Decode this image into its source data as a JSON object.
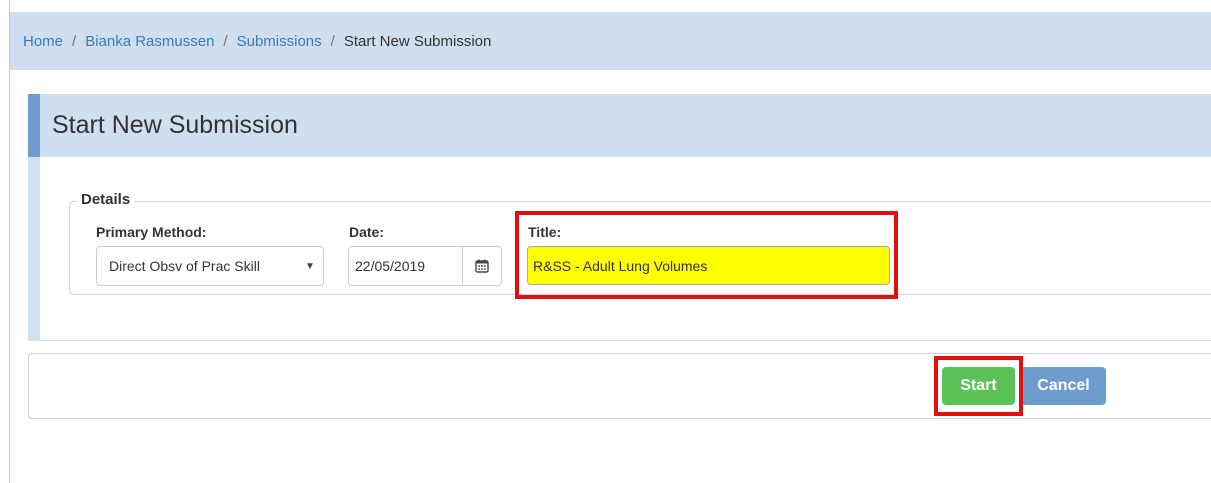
{
  "breadcrumb": {
    "items": [
      {
        "label": "Home"
      },
      {
        "label": "Bianka Rasmussen"
      },
      {
        "label": "Submissions"
      }
    ],
    "separator": "/",
    "current": "Start New Submission"
  },
  "panel": {
    "title": "Start New Submission"
  },
  "details": {
    "legend": "Details",
    "primary_method": {
      "label": "Primary Method:",
      "value": "Direct Obsv of Prac Skill"
    },
    "date": {
      "label": "Date:",
      "value": "22/05/2019"
    },
    "title": {
      "label": "Title:",
      "value": "R&SS - Adult Lung Volumes"
    }
  },
  "actions": {
    "start_label": "Start",
    "cancel_label": "Cancel"
  },
  "colors": {
    "header_bg": "#cfdff0",
    "accent": "#6d9ccd",
    "start_button": "#5cc159",
    "cancel_button": "#6d9ccd",
    "title_highlight": "#ffff00",
    "callout_border": "#e01010"
  },
  "icons": {
    "date_picker": "calendar-icon",
    "select_arrow": "caret-down-icon"
  }
}
